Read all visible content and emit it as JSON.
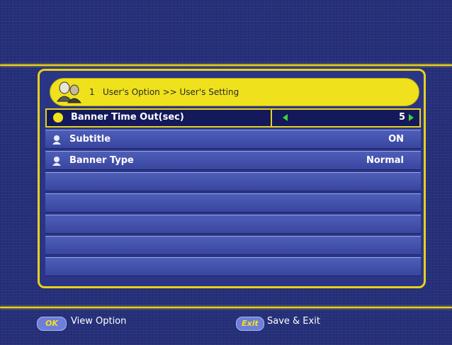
{
  "header": {
    "number": "1",
    "title": "User's Option >> User's Setting"
  },
  "menu": {
    "items": [
      {
        "label": "Banner Time Out(sec)",
        "value": "5",
        "selected": true
      },
      {
        "label": "Subtitle",
        "value": "ON",
        "selected": false
      },
      {
        "label": "Banner Type",
        "value": "Normal",
        "selected": false
      }
    ],
    "empty_rows": 5
  },
  "footer": {
    "ok_badge": "OK",
    "ok_label": "View Option",
    "exit_badge": "Exit",
    "exit_label": "Save & Exit"
  },
  "colors": {
    "accent_yellow": "#e5d11d",
    "background_blue": "#26307a",
    "arrow_green": "#3fd23c"
  }
}
